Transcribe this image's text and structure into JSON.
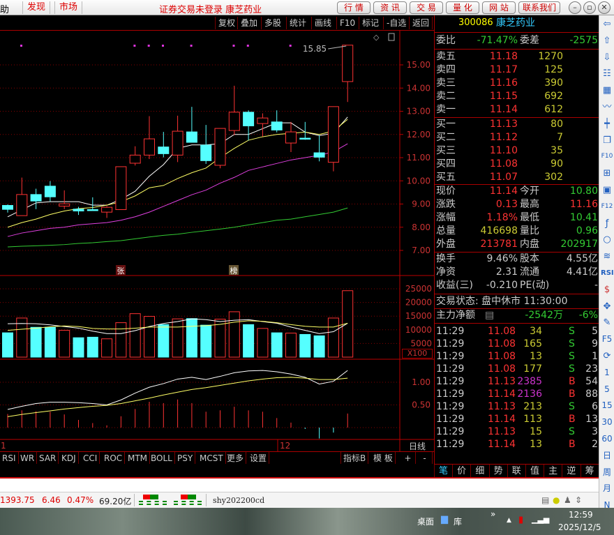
{
  "topbar": {
    "left_partial": "助",
    "tabs": [
      "发现",
      "市场"
    ],
    "title": "证券交易未登录  康芝药业",
    "buttons": [
      "行 情",
      "资 讯",
      "交 易",
      "量 化",
      "网 站",
      "联系我们"
    ],
    "window_controls": [
      "minimize-icon",
      "restore-icon",
      "close-icon"
    ]
  },
  "toolbar": {
    "items": [
      "复权",
      "叠加",
      "多股",
      "统计",
      "画线",
      "F10",
      "标记",
      "-自选",
      "返回"
    ]
  },
  "stock": {
    "code": "300086",
    "name": "康芝药业"
  },
  "quote": {
    "weibi_label": "委比",
    "weibi": "-71.47%",
    "weicha_label": "委差",
    "weicha": "-2575",
    "asks": [
      {
        "label": "卖五",
        "price": "11.18",
        "vol": "1270"
      },
      {
        "label": "卖四",
        "price": "11.17",
        "vol": "125"
      },
      {
        "label": "卖三",
        "price": "11.16",
        "vol": "390"
      },
      {
        "label": "卖二",
        "price": "11.15",
        "vol": "692"
      },
      {
        "label": "卖一",
        "price": "11.14",
        "vol": "612"
      }
    ],
    "bids": [
      {
        "label": "买一",
        "price": "11.13",
        "vol": "80"
      },
      {
        "label": "买二",
        "price": "11.12",
        "vol": "7"
      },
      {
        "label": "买三",
        "price": "11.10",
        "vol": "35"
      },
      {
        "label": "买四",
        "price": "11.08",
        "vol": "90"
      },
      {
        "label": "买五",
        "price": "11.07",
        "vol": "302"
      }
    ],
    "stats": [
      {
        "l1": "现价",
        "v1": "11.14",
        "c1": "r",
        "l2": "今开",
        "v2": "10.80",
        "c2": "g"
      },
      {
        "l1": "涨跌",
        "v1": "0.13",
        "c1": "r",
        "l2": "最高",
        "v2": "11.16",
        "c2": "r"
      },
      {
        "l1": "涨幅",
        "v1": "1.18%",
        "c1": "r",
        "l2": "最低",
        "v2": "10.41",
        "c2": "g"
      },
      {
        "l1": "总量",
        "v1": "416698",
        "c1": "y",
        "l2": "量比",
        "v2": "0.96",
        "c2": "g"
      },
      {
        "l1": "外盘",
        "v1": "213781",
        "c1": "r",
        "l2": "内盘",
        "v2": "202917",
        "c2": "g"
      }
    ],
    "fundamentals": [
      {
        "l1": "换手",
        "v1": "9.46%",
        "l2": "股本",
        "v2": "4.55亿"
      },
      {
        "l1": "净资",
        "v1": "2.31",
        "l2": "流通",
        "v2": "4.41亿"
      },
      {
        "l1": "收益(三)",
        "v1": "-0.210",
        "l2": "PE(动)",
        "v2": "-"
      }
    ],
    "trade_status": "交易状态: 盘中休市 11:30:00",
    "main_flow_label": "主力净额",
    "main_flow": "-2542万",
    "main_flow_pct": "-6%"
  },
  "ticks": [
    {
      "t": "11:29",
      "p": "11.08",
      "v": "34",
      "s": "S",
      "n": "5"
    },
    {
      "t": "11:29",
      "p": "11.08",
      "v": "165",
      "s": "S",
      "n": "9"
    },
    {
      "t": "11:29",
      "p": "11.08",
      "v": "13",
      "s": "S",
      "n": "1"
    },
    {
      "t": "11:29",
      "p": "11.08",
      "v": "177",
      "s": "S",
      "n": "23"
    },
    {
      "t": "11:29",
      "p": "11.13",
      "v": "2385",
      "s": "B",
      "n": "54"
    },
    {
      "t": "11:29",
      "p": "11.14",
      "v": "2136",
      "s": "B",
      "n": "88"
    },
    {
      "t": "11:29",
      "p": "11.13",
      "v": "213",
      "s": "S",
      "n": "6"
    },
    {
      "t": "11:29",
      "p": "11.14",
      "v": "113",
      "s": "B",
      "n": "13"
    },
    {
      "t": "11:29",
      "p": "11.13",
      "v": "15",
      "s": "S",
      "n": "3"
    },
    {
      "t": "11:29",
      "p": "11.14",
      "v": "13",
      "s": "B",
      "n": "2"
    }
  ],
  "bottom_tabs": [
    "笔",
    "价",
    "细",
    "势",
    "联",
    "值",
    "主",
    "逆",
    "筹"
  ],
  "indicator_tabs": [
    "RSI",
    "WR",
    "SAR",
    "KDJ",
    "CCI",
    "ROC",
    "MTM",
    "BOLL",
    "PSY",
    "MCST",
    "更多",
    "设置"
  ],
  "indicator_right": [
    "指标B",
    "模 板",
    "+",
    "-"
  ],
  "right_icons": [
    "back-icon",
    "up-icon",
    "down-icon",
    "list-icon",
    "grid-icon",
    "line-chart-icon",
    "candle-icon",
    "window-icon",
    "f10-icon",
    "tree-icon",
    "book-icon",
    "f12-icon",
    "formula-icon",
    "circle-icon",
    "wave-icon",
    "RSI",
    "dollar-icon",
    "move-icon",
    "pencil-icon",
    "F5",
    "refresh-icon",
    "1",
    "5",
    "15",
    "30",
    "60",
    "日",
    "周",
    "月",
    "N"
  ],
  "chart": {
    "price_ticks": [
      "15.00",
      "14.00",
      "13.00",
      "12.00",
      "11.00",
      "10.00",
      "9.00",
      "8.00",
      "7.00"
    ],
    "vol_ticks": [
      "25000",
      "20000",
      "15000",
      "10000",
      "5000"
    ],
    "vol_unit": "X100",
    "macd_ticks": [
      "1.00",
      "0.50"
    ],
    "max_label": "15.85",
    "badges": [
      "张",
      "榜"
    ],
    "date_labels": [
      "1",
      "12"
    ],
    "period": "日线"
  },
  "chart_data": {
    "type": "candlestick",
    "ylim": [
      6.5,
      16
    ],
    "candles": [
      [
        8.94,
        8.98,
        8.63,
        8.77
      ],
      [
        8.5,
        10.14,
        8.5,
        9.41
      ],
      [
        9.41,
        9.66,
        8.78,
        9.13
      ],
      [
        9.77,
        9.99,
        9.11,
        9.31
      ],
      [
        8.91,
        9.59,
        8.78,
        9.01
      ],
      [
        8.78,
        8.88,
        8.53,
        8.7
      ],
      [
        8.76,
        9.29,
        8.73,
        8.73
      ],
      [
        8.65,
        8.91,
        8.4,
        8.86
      ],
      [
        8.76,
        10.61,
        8.76,
        10.61
      ],
      [
        10.76,
        11.49,
        10.66,
        11.11
      ],
      [
        11.11,
        12.79,
        10.94,
        11.81
      ],
      [
        11.46,
        12.11,
        11.01,
        11.17
      ],
      [
        11.11,
        12.81,
        10.81,
        12.14
      ],
      [
        12.11,
        13.19,
        11.66,
        11.66
      ],
      [
        11.54,
        12.41,
        10.73,
        10.87
      ],
      [
        10.67,
        12.26,
        10.54,
        12.26
      ],
      [
        12.17,
        14.1,
        11.97,
        12.96
      ],
      [
        12.96,
        13.04,
        11.74,
        12.37
      ],
      [
        12.47,
        12.91,
        11.91,
        12.71
      ],
      [
        12.54,
        13.04,
        12.09,
        12.19
      ],
      [
        11.63,
        12.54,
        11.24,
        12.11
      ],
      [
        11.84,
        12.54,
        11.77,
        11.8
      ],
      [
        11.21,
        11.97,
        10.84,
        11.02
      ],
      [
        10.8,
        13.2,
        10.41,
        13.2
      ],
      [
        14.28,
        15.85,
        13.4,
        15.85
      ]
    ],
    "ma": [
      {
        "name": "MA5",
        "color": "#ffffff",
        "values": [
          8.45,
          8.75,
          9.05,
          9.1,
          9.1,
          9.1,
          8.95,
          8.95,
          9.2,
          9.55,
          10.2,
          10.7,
          11.4,
          11.55,
          11.55,
          11.6,
          12.0,
          12.0,
          12.25,
          12.5,
          12.5,
          12.1,
          11.95,
          12.05,
          12.75
        ]
      },
      {
        "name": "MA10",
        "color": "#ffff66",
        "values": [
          8.0,
          8.2,
          8.35,
          8.55,
          8.7,
          8.8,
          8.85,
          8.95,
          9.1,
          9.35,
          9.7,
          9.8,
          10.1,
          10.35,
          10.55,
          11.0,
          11.4,
          11.75,
          11.9,
          12.0,
          12.05,
          12.1,
          12.0,
          12.15,
          12.65
        ]
      },
      {
        "name": "MA20",
        "color": "#e040e0",
        "values": [
          7.6,
          7.75,
          7.85,
          7.95,
          8.0,
          8.1,
          8.15,
          8.2,
          8.3,
          8.45,
          8.65,
          8.9,
          9.15,
          9.4,
          9.6,
          9.9,
          10.15,
          10.45,
          10.6,
          10.75,
          10.9,
          11.0,
          11.1,
          11.25,
          11.6
        ]
      },
      {
        "name": "MA60",
        "color": "#33cc33",
        "values": [
          7.15,
          7.18,
          7.2,
          7.22,
          7.25,
          7.3,
          7.33,
          7.38,
          7.42,
          7.5,
          7.58,
          7.65,
          7.7,
          7.78,
          7.85,
          7.92,
          8.0,
          8.1,
          8.2,
          8.3,
          8.35,
          8.45,
          8.55,
          8.65,
          8.83
        ]
      }
    ],
    "volume": [
      8900,
      14300,
      10900,
      10900,
      9800,
      7100,
      7300,
      6700,
      12600,
      15900,
      14900,
      11900,
      14000,
      14100,
      11700,
      13900,
      16600,
      11900,
      10500,
      8900,
      8800,
      8300,
      7800,
      14300,
      24300
    ],
    "vol_ma": [
      {
        "color": "#ffffff",
        "values": [
          12200,
          12300,
          12200,
          11800,
          11200,
          10600,
          9500,
          8600,
          8600,
          9700,
          11200,
          12300,
          13000,
          14000,
          13700,
          13000,
          13500,
          13700,
          13000,
          12400,
          11000,
          9800,
          8600,
          9300,
          12400
        ]
      },
      {
        "color": "#ffff66",
        "values": [
          9800,
          10200,
          10600,
          11100,
          11400,
          11200,
          10500,
          10300,
          10300,
          10600,
          11000,
          11000,
          11000,
          11300,
          11500,
          12000,
          12800,
          13300,
          13100,
          12600,
          11900,
          11300,
          11000,
          11000,
          12400
        ]
      }
    ],
    "macd_hist": [
      0.3,
      0.38,
      0.36,
      0.35,
      0.29,
      0.17,
      0.1,
      0.05,
      0.25,
      0.41,
      0.57,
      0.54,
      0.62,
      0.54,
      0.35,
      0.38,
      0.46,
      0.38,
      0.35,
      0.21,
      0.11,
      -0.03,
      -0.24,
      -0.11,
      0.31
    ],
    "dif": [
      0.4,
      0.47,
      0.53,
      0.56,
      0.56,
      0.55,
      0.53,
      0.5,
      0.61,
      0.76,
      0.89,
      0.97,
      1.07,
      1.11,
      1.06,
      1.13,
      1.21,
      1.25,
      1.26,
      1.23,
      1.18,
      1.11,
      0.96,
      1.02,
      1.26
    ],
    "dea": [
      0.24,
      0.29,
      0.33,
      0.37,
      0.41,
      0.44,
      0.47,
      0.49,
      0.53,
      0.59,
      0.65,
      0.72,
      0.78,
      0.84,
      0.88,
      0.93,
      0.98,
      1.03,
      1.07,
      1.1,
      1.11,
      1.09,
      1.06,
      1.06,
      1.09
    ],
    "marker_candles": [
      1,
      9,
      10,
      11,
      13,
      16,
      17,
      20
    ]
  },
  "statusbar": {
    "index": "1393.75",
    "change": "6.46",
    "pct": "0.47%",
    "amount": "69.20亿",
    "user": "shy202200cd"
  },
  "taskbar": {
    "desktop": "桌面",
    "library": "库",
    "time": "12:59",
    "date": "2025/12/5"
  }
}
